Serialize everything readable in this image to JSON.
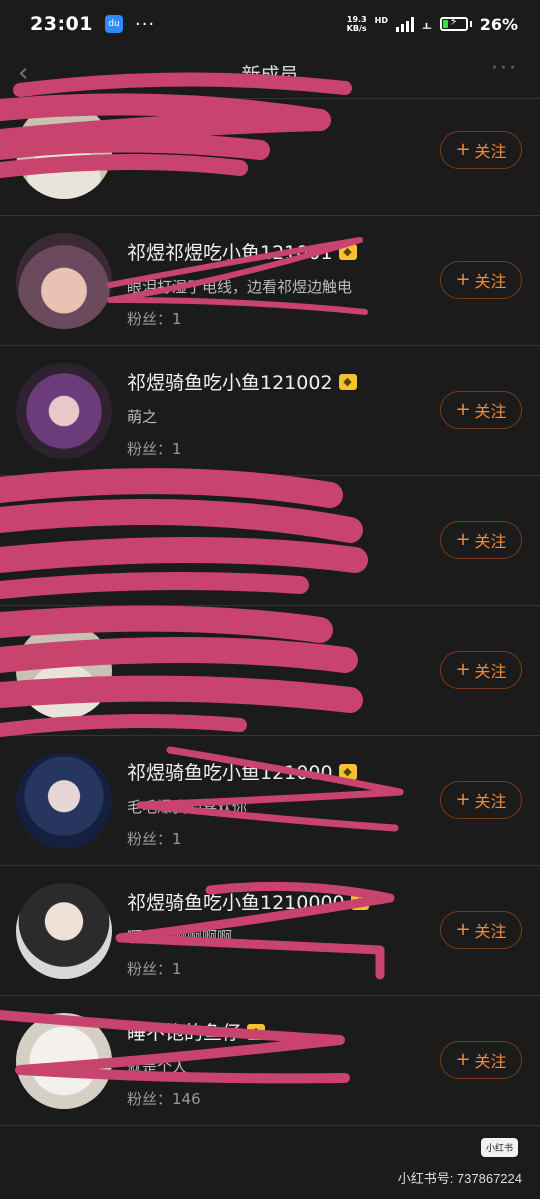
{
  "status_bar": {
    "time": "23:01",
    "app_icon_text": "du",
    "dots": "···",
    "speed_value": "19.3",
    "speed_unit": "KB/s",
    "hd": "HD",
    "battery": "26%",
    "battery_level_percent": 26,
    "battery_fill_color": "#3ddc4a"
  },
  "nav": {
    "title": "新成员"
  },
  "follow_label": "关注",
  "colors": {
    "accent": "#f08a3c",
    "scribble": "#c8446e",
    "background": "#1b1b1b"
  },
  "members": [
    {
      "name": "",
      "signature": "",
      "fans": "",
      "redacted": true,
      "avatar": "light-avatar"
    },
    {
      "name": "祁煜祁煜吃小鱼121001",
      "signature": "眼泪打湿了电线，边看祁煜边触电",
      "fans": "粉丝：1",
      "badge": true,
      "avatar": "dark-hair-avatar"
    },
    {
      "name": "祁煜骑鱼吃小鱼121002",
      "signature": "萌之",
      "fans": "粉丝：1",
      "badge": true,
      "avatar": "purple-avatar"
    },
    {
      "name": "",
      "signature": "",
      "fans": "",
      "redacted": true,
      "avatar": "none"
    },
    {
      "name": "",
      "signature": "",
      "fans": "",
      "redacted": true,
      "avatar": "light-avatar"
    },
    {
      "name": "祁煜骑鱼吃小鱼121000",
      "signature": "毛毛爆我们喜欢你",
      "fans": "粉丝：1",
      "badge": true,
      "avatar": "blue-avatar"
    },
    {
      "name": "祁煜骑鱼吃小鱼1210000",
      "signature": "啊啊啊啊啊啊啊",
      "fans": "粉丝：1",
      "badge": true,
      "avatar": "sunglasses-avatar"
    },
    {
      "name": "睡不饱的鱼仔",
      "signature": "就是个人",
      "fans": "粉丝：146",
      "badge": true,
      "avatar": "sketch-avatar"
    }
  ],
  "watermark": {
    "badge": "小红书",
    "text": "小红书号: 737867224"
  }
}
